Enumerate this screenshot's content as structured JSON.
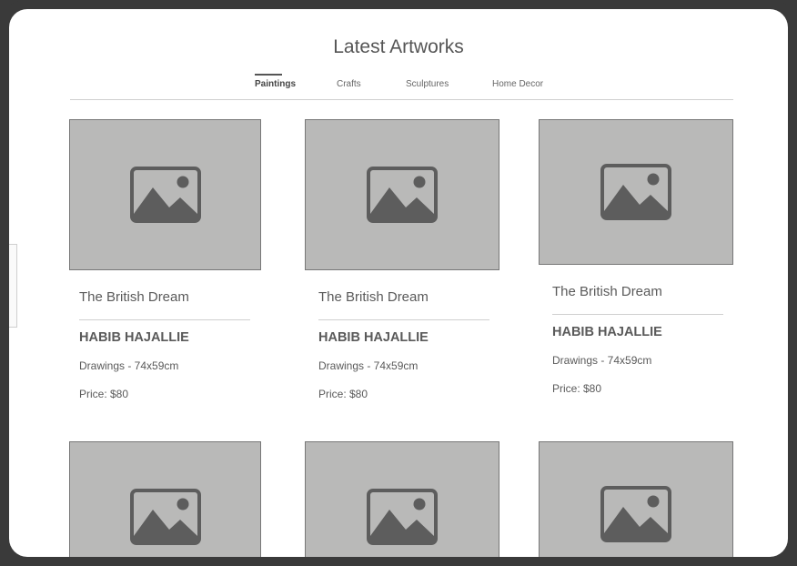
{
  "page": {
    "title": "Latest Artworks"
  },
  "tabs": [
    {
      "label": "Paintings",
      "active": true
    },
    {
      "label": "Crafts",
      "active": false
    },
    {
      "label": "Sculptures",
      "active": false
    },
    {
      "label": "Home Decor",
      "active": false
    }
  ],
  "cards": [
    {
      "title": "The British Dream",
      "artist": "HABIB HAJALLIE",
      "details": "Drawings - 74x59cm",
      "price": "Price: $80",
      "image_icon": "image-placeholder-icon"
    },
    {
      "title": "The British Dream",
      "artist": "HABIB HAJALLIE",
      "details": "Drawings - 74x59cm",
      "price": "Price: $80",
      "image_icon": "image-placeholder-icon"
    },
    {
      "title": "The British Dream",
      "artist": "HABIB HAJALLIE",
      "details": "Drawings - 74x59cm",
      "price": "Price: $80",
      "image_icon": "image-placeholder-icon"
    },
    {
      "image_icon": "image-placeholder-icon"
    },
    {
      "image_icon": "image-placeholder-icon"
    },
    {
      "image_icon": "image-placeholder-icon"
    }
  ],
  "colors": {
    "frame": "#3a3a3a",
    "placeholder": "#b9b9b8",
    "icon": "#5d5d5d",
    "text": "#555555"
  }
}
